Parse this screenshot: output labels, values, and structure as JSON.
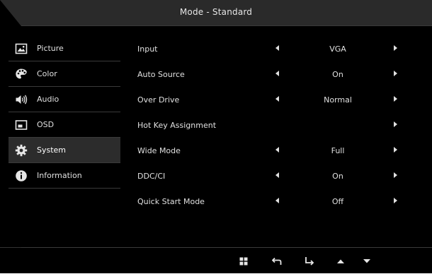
{
  "title": "Mode - Standard",
  "sidebar": {
    "items": [
      {
        "label": "Picture",
        "icon": "picture-icon",
        "active": false
      },
      {
        "label": "Color",
        "icon": "palette-icon",
        "active": false
      },
      {
        "label": "Audio",
        "icon": "speaker-icon",
        "active": false
      },
      {
        "label": "OSD",
        "icon": "osd-window-icon",
        "active": false
      },
      {
        "label": "System",
        "icon": "gear-icon",
        "active": true
      },
      {
        "label": "Information",
        "icon": "info-icon",
        "active": false
      }
    ]
  },
  "settings": [
    {
      "label": "Input",
      "value": "VGA",
      "has_left": true
    },
    {
      "label": "Auto Source",
      "value": "On",
      "has_left": true
    },
    {
      "label": "Over Drive",
      "value": "Normal",
      "has_left": true
    },
    {
      "label": "Hot Key Assignment",
      "value": "",
      "has_left": false
    },
    {
      "label": "Wide Mode",
      "value": "Full",
      "has_left": true
    },
    {
      "label": "DDC/CI",
      "value": "On",
      "has_left": true
    },
    {
      "label": "Quick Start Mode",
      "value": "Off",
      "has_left": true
    }
  ],
  "bottom_icons": [
    "menu-grid-icon",
    "back-icon",
    "enter-icon",
    "up-arrow-icon",
    "down-arrow-icon"
  ],
  "colors": {
    "background": "#000000",
    "text": "#e0e0e0",
    "active_item": "#2c2c2c"
  }
}
